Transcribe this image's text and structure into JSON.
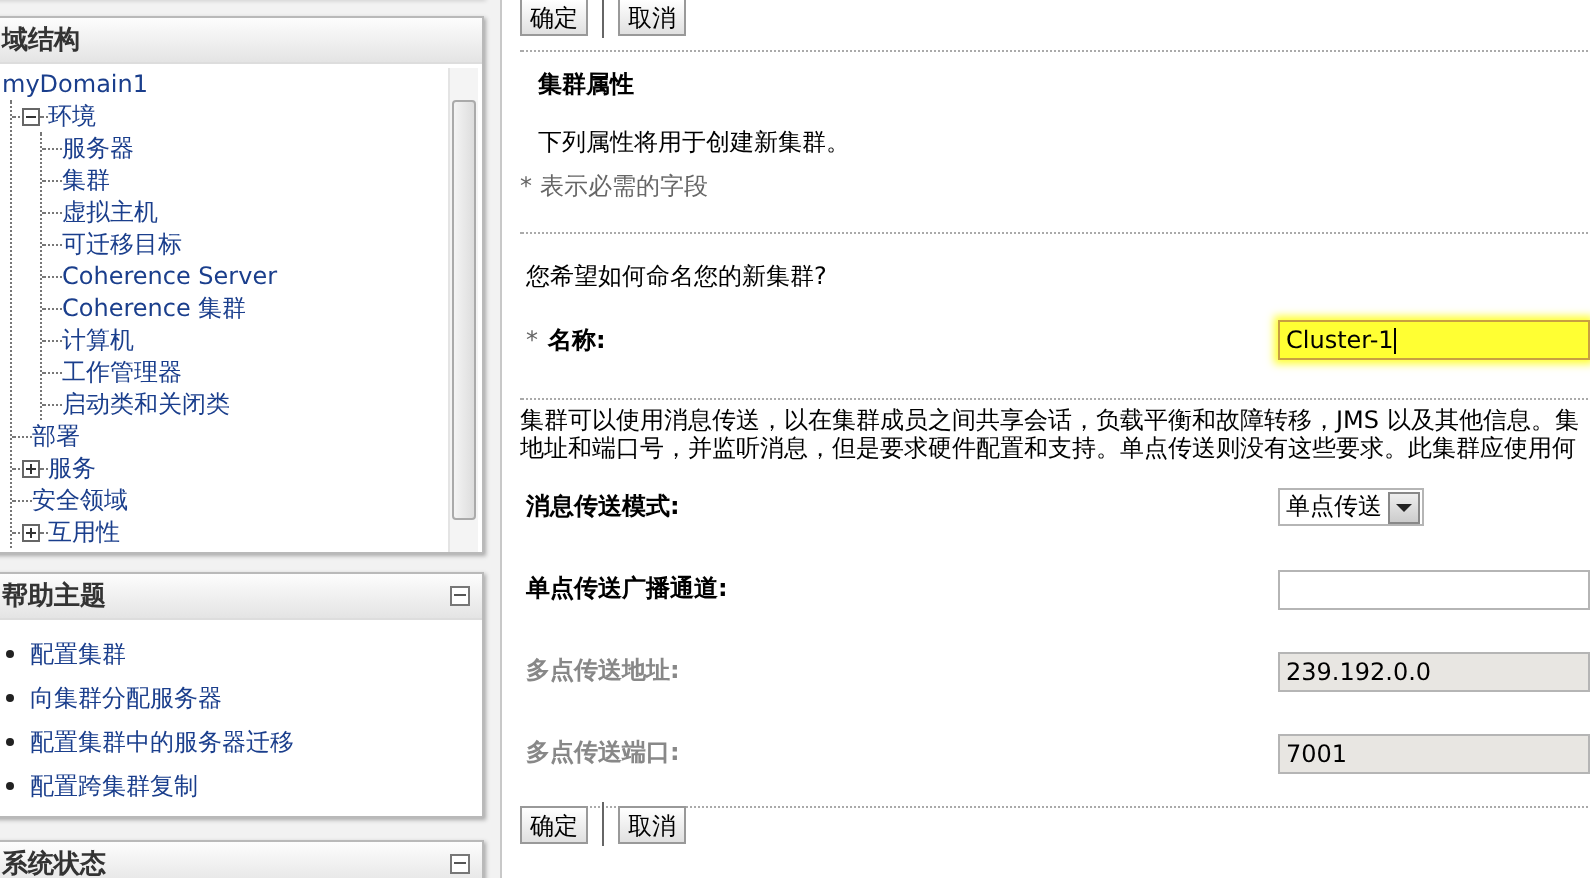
{
  "domain_structure": {
    "title": "域结构",
    "tree": [
      {
        "label": "myDomain1",
        "children": [
          {
            "label": "环境",
            "expanded": true,
            "children": [
              {
                "label": "服务器"
              },
              {
                "label": "集群"
              },
              {
                "label": "虚拟主机"
              },
              {
                "label": "可迁移目标"
              },
              {
                "label": "Coherence Server"
              },
              {
                "label": "Coherence 集群"
              },
              {
                "label": "计算机"
              },
              {
                "label": "工作管理器"
              },
              {
                "label": "启动类和关闭类"
              }
            ]
          },
          {
            "label": "部署"
          },
          {
            "label": "服务",
            "expanded": false
          },
          {
            "label": "安全领域"
          },
          {
            "label": "互用性",
            "expanded": false
          }
        ]
      }
    ]
  },
  "help_topics": {
    "title": "帮助主题",
    "links": [
      "配置集群",
      "向集群分配服务器",
      "配置集群中的服务器迁移",
      "配置跨集群复制"
    ]
  },
  "system_status": {
    "title": "系统状态"
  },
  "top_buttons": [
    "确定",
    "取消"
  ],
  "section": {
    "title": "集群属性",
    "intro": "下列属性将用于创建新集群。",
    "required_note": "* 表示必需的字段"
  },
  "name_question": "您希望如何命名您的新集群?",
  "name_field": {
    "required_mark": "*",
    "label": "名称:",
    "value": "Cluster-1",
    "focused": true
  },
  "description_lines": [
    "集群可以使用消息传送，以在集群成员之间共享会话，负载平衡和故障转移，JMS 以及其他信息。集",
    "地址和端口号，并监听消息，但是要求硬件配置和支持。单点传送则没有这些要求。此集群应使用何"
  ],
  "fields": [
    {
      "label": "消息传送模式:",
      "kind": "select",
      "value": "单点传送",
      "disabled": false
    },
    {
      "label": "单点传送广播通道:",
      "kind": "text",
      "disabled": false
    },
    {
      "label": "多点传送地址:",
      "kind": "text",
      "value": "239.192.0.0",
      "disabled": true
    },
    {
      "label": "多点传送端口:",
      "kind": "text",
      "value": "7001",
      "disabled": true
    }
  ],
  "bottom_buttons": [
    "确定",
    "取消"
  ]
}
